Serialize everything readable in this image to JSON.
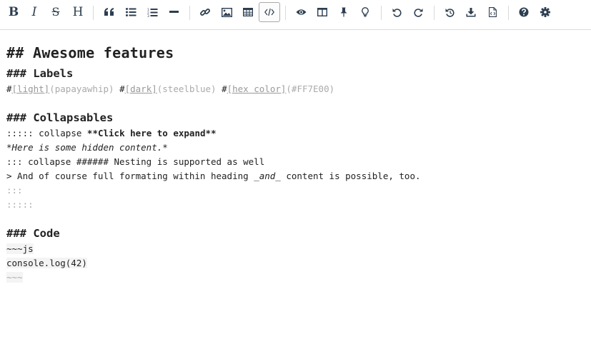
{
  "toolbar": {
    "buttons": [
      {
        "name": "bold",
        "glyph": "B"
      },
      {
        "name": "italic",
        "glyph": "I"
      },
      {
        "name": "strikethrough",
        "glyph": "S"
      },
      {
        "name": "heading",
        "glyph": "H"
      },
      {
        "name": "quote"
      },
      {
        "name": "unordered-list"
      },
      {
        "name": "ordered-list"
      },
      {
        "name": "horizontal-rule"
      },
      {
        "name": "link"
      },
      {
        "name": "image"
      },
      {
        "name": "table"
      },
      {
        "name": "code",
        "active": true
      },
      {
        "name": "preview"
      },
      {
        "name": "side-by-side"
      },
      {
        "name": "pin"
      },
      {
        "name": "lightbulb"
      },
      {
        "name": "undo"
      },
      {
        "name": "redo"
      },
      {
        "name": "history"
      },
      {
        "name": "download"
      },
      {
        "name": "export-html"
      },
      {
        "name": "help"
      },
      {
        "name": "settings"
      }
    ]
  },
  "editor": {
    "h2_prefix": "##",
    "h2_text": "Awesome features",
    "labels_prefix": "###",
    "labels_text": "Labels",
    "label1_hash": "#",
    "label1_text": "[light]",
    "label1_param": "(papayawhip)",
    "label2_hash": "#",
    "label2_text": "[dark]",
    "label2_param": "(steelblue)",
    "label3_hash": "#",
    "label3_text": "[hex color]",
    "label3_param": "(#FF7E00)",
    "collapsables_prefix": "###",
    "collapsables_text": "Collapsables",
    "collapse_open": ":::::",
    "collapse_keyword": "collapse",
    "collapse_stars_open": "**",
    "collapse_title": "Click here to expand",
    "collapse_stars_close": "**",
    "hidden_line": "*Here is some hidden content.*",
    "nested_line": "::: collapse ###### Nesting is supported as well",
    "quote_prefix": "> And of course full formating within heading ",
    "quote_and_open": "_",
    "quote_and": "and",
    "quote_and_close": "_",
    "quote_suffix": " content is possible, too.",
    "close_inner": ":::",
    "close_outer": ":::::",
    "code_prefix": "###",
    "code_text": "Code",
    "fence_open": "~~~js",
    "code_line": "console.log(42)",
    "fence_close": "~~~"
  }
}
